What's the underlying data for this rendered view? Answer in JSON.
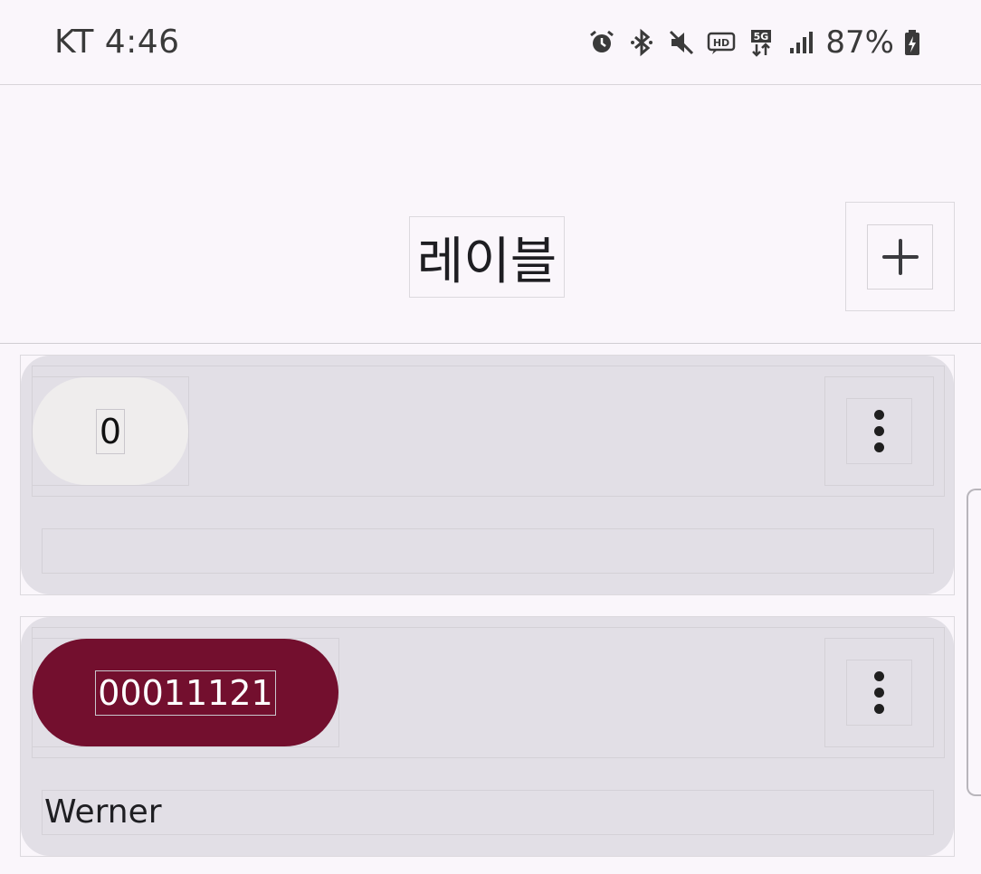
{
  "status_bar": {
    "carrier_time": "KT 4:46",
    "battery": "87%",
    "icons": [
      "alarm-icon",
      "bluetooth-icon",
      "mute-icon",
      "hd-voice-icon",
      "5g-icon",
      "signal-icon",
      "battery-icon"
    ]
  },
  "app_bar": {
    "title": "레이블",
    "add_icon": "plus-icon"
  },
  "labels": [
    {
      "chip": "0",
      "chip_color": "#efeded",
      "chip_text_color": "#111111",
      "name": "",
      "menu_icon": "more-vertical-icon"
    },
    {
      "chip": "00011121",
      "chip_color": "#730f2e",
      "chip_text_color": "#ffffff",
      "name": "Werner",
      "menu_icon": "more-vertical-icon"
    }
  ]
}
